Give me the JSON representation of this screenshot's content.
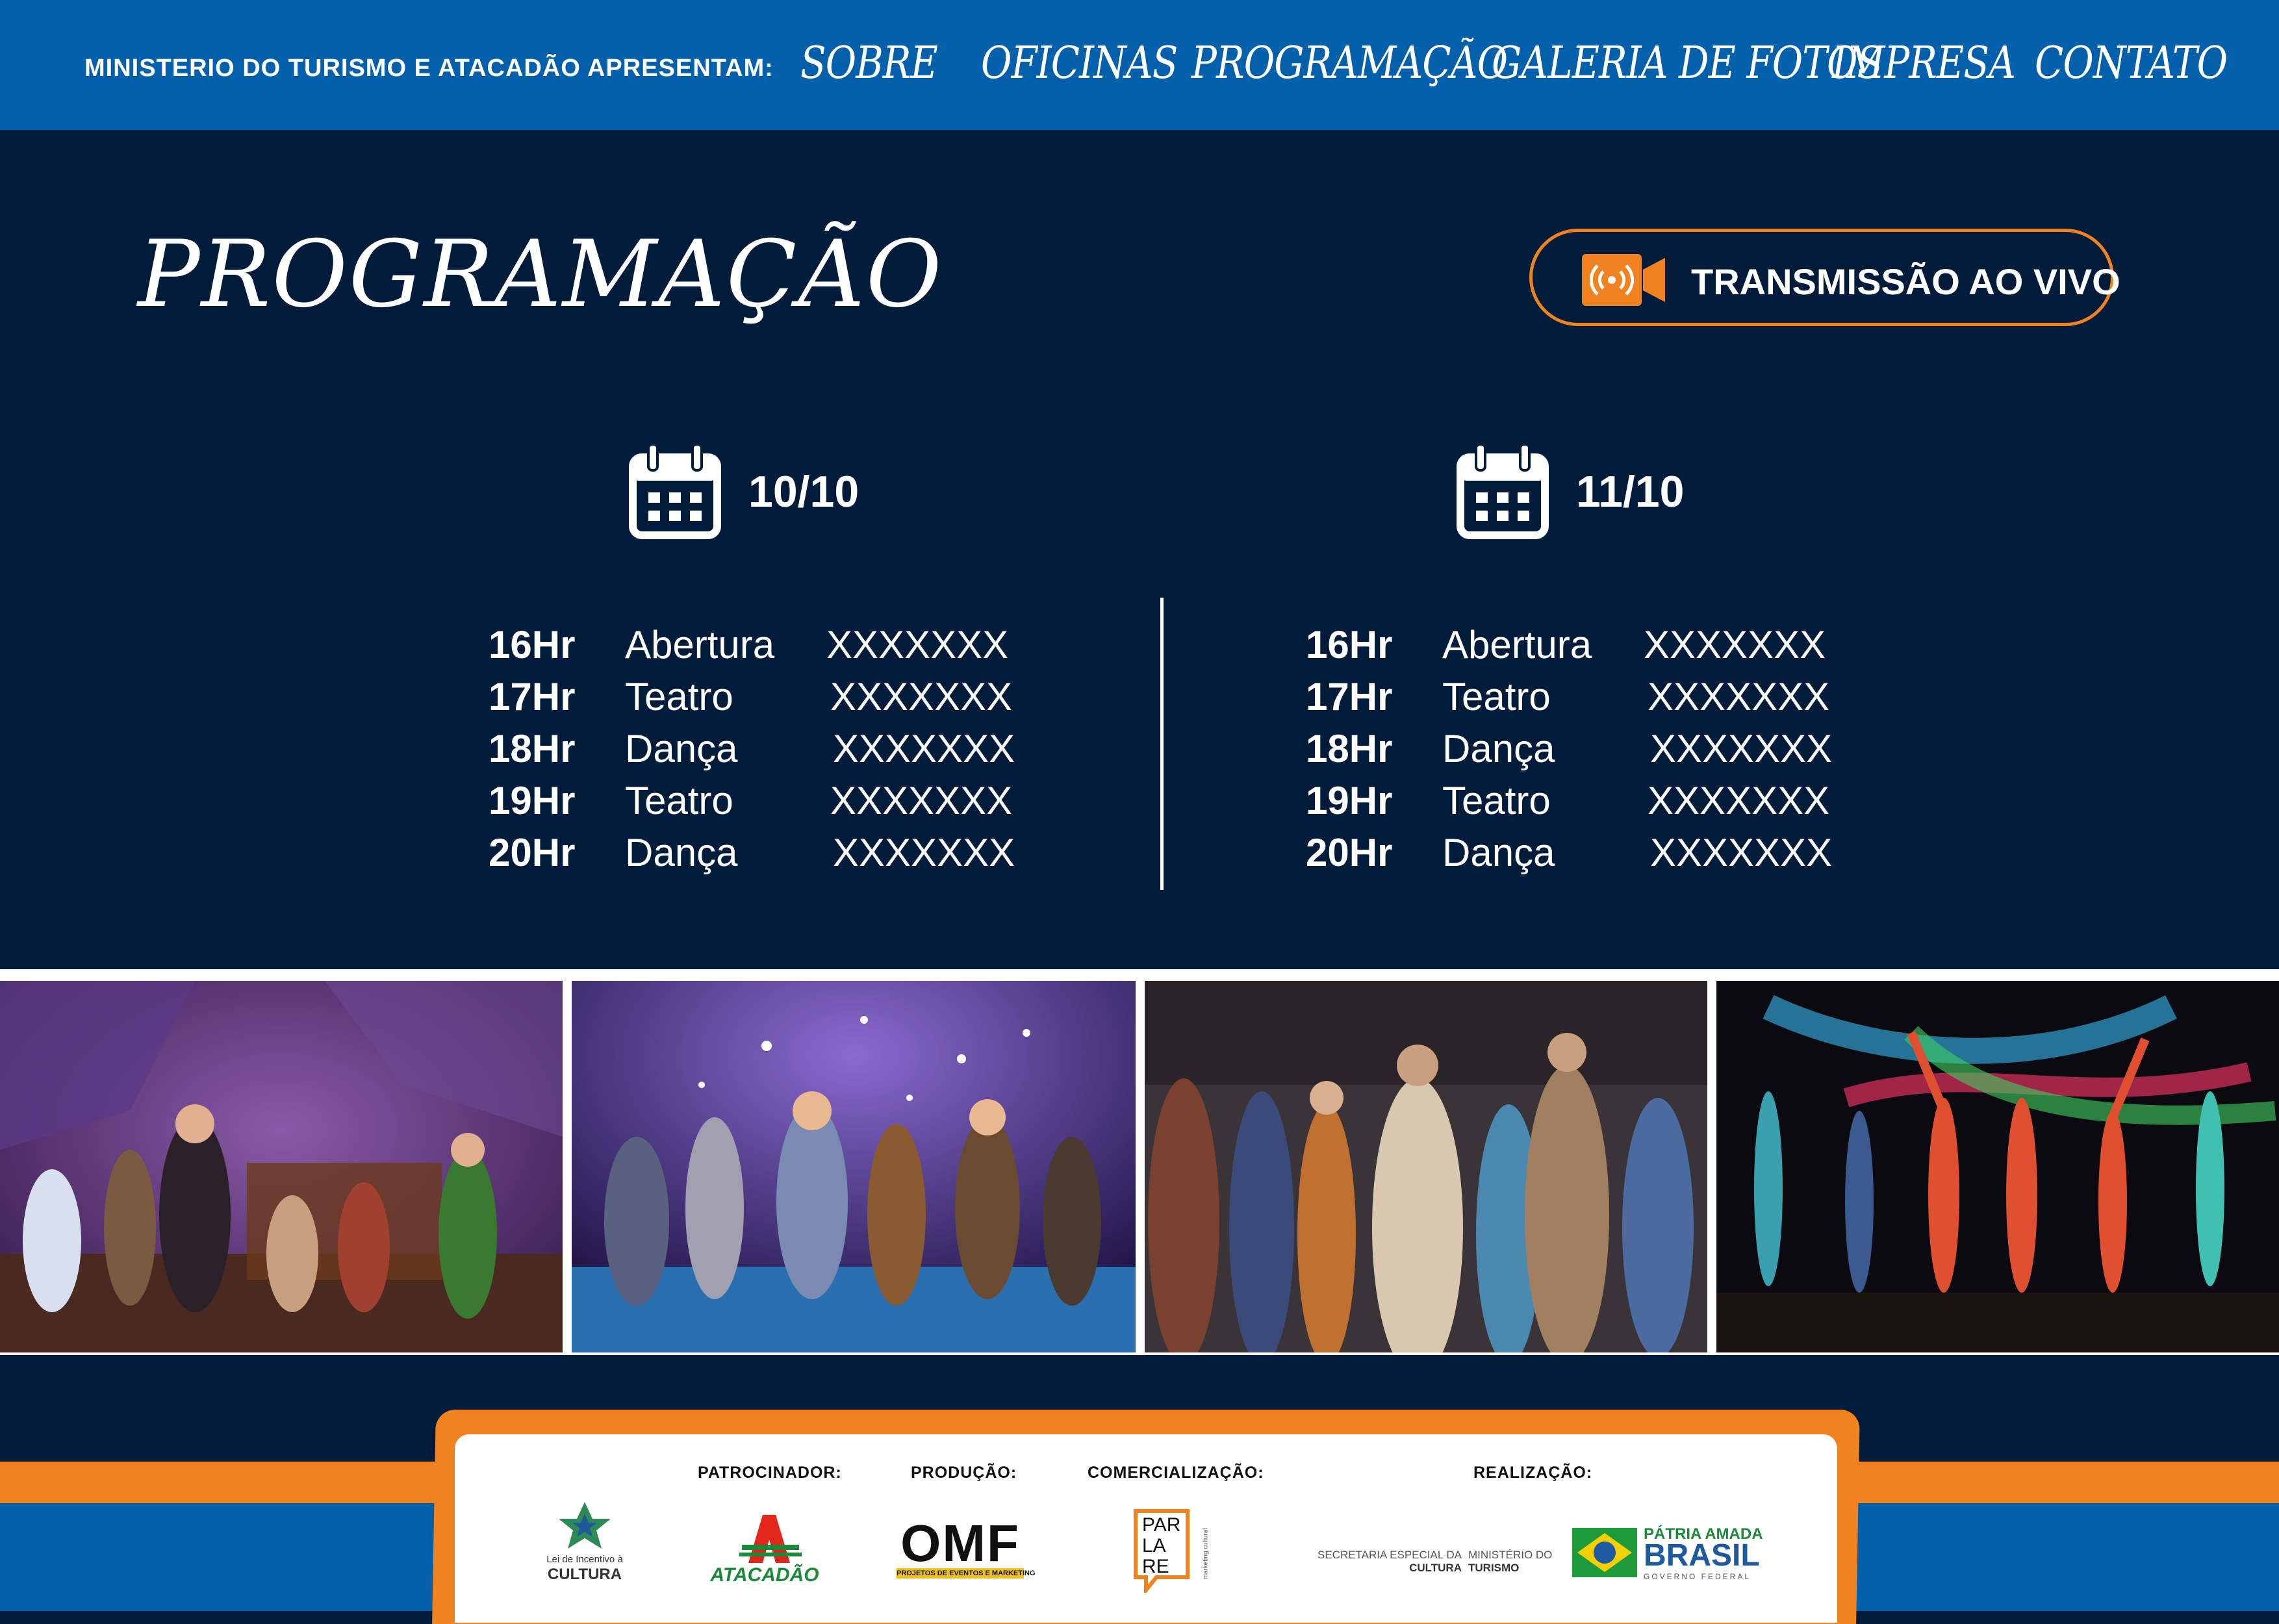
{
  "nav": {
    "presenter": "MINISTERIO DO TURISMO E ATACADÃO APRESENTAM:",
    "items": [
      "SOBRE",
      "OFICINAS",
      "PROGRAMAÇÃO",
      "GALERIA DE FOTOS",
      "IMPRESA",
      "CONTATO"
    ]
  },
  "page": {
    "title": "PROGRAMAÇÃO",
    "live_button": "TRANSMISSÃO AO VIVO"
  },
  "days": [
    {
      "date": "10/10",
      "schedule": [
        {
          "time": "16Hr",
          "activity": "Abertura",
          "detail": "XXXXXXX"
        },
        {
          "time": "17Hr",
          "activity": "Teatro",
          "detail": "XXXXXXX"
        },
        {
          "time": "18Hr",
          "activity": "Dança",
          "detail": "XXXXXXX"
        },
        {
          "time": "19Hr",
          "activity": "Teatro",
          "detail": "XXXXXXX"
        },
        {
          "time": "20Hr",
          "activity": "Dança",
          "detail": "XXXXXXX"
        }
      ]
    },
    {
      "date": "11/10",
      "schedule": [
        {
          "time": "16Hr",
          "activity": "Abertura",
          "detail": "XXXXXXX"
        },
        {
          "time": "17Hr",
          "activity": "Teatro",
          "detail": "XXXXXXX"
        },
        {
          "time": "18Hr",
          "activity": "Dança",
          "detail": "XXXXXXX"
        },
        {
          "time": "19Hr",
          "activity": "Teatro",
          "detail": "XXXXXXX"
        },
        {
          "time": "20Hr",
          "activity": "Dança",
          "detail": "XXXXXXX"
        }
      ]
    }
  ],
  "footer": {
    "patrocinador": "PATROCINADOR:",
    "producao": "PRODUÇÃO:",
    "comercializacao": "COMERCIALIZAÇÃO:",
    "realizacao": "REALIZAÇÃO:",
    "logos": {
      "cultura_small": "Lei de Incentivo à",
      "cultura": "CULTURA",
      "atacadao": "ATACADÃO",
      "omf": "OMF",
      "omf_sub": "PROJETOS DE EVENTOS E MARKETING",
      "parlare_1": "PAR",
      "parlare_2": "LA",
      "parlare_3": "RE",
      "parlare_side": "marketing cultural",
      "secretaria_1": "SECRETARIA ESPECIAL DA",
      "secretaria_2": "CULTURA",
      "ministerio_1": "MINISTÉRIO DO",
      "ministerio_2": "TURISMO",
      "patria": "PÁTRIA AMADA",
      "brasil": "BRASIL",
      "governo": "GOVERNO FEDERAL"
    }
  },
  "colors": {
    "nav_blue": "#0460ab",
    "navy": "#011c3a",
    "orange": "#f0831f"
  }
}
